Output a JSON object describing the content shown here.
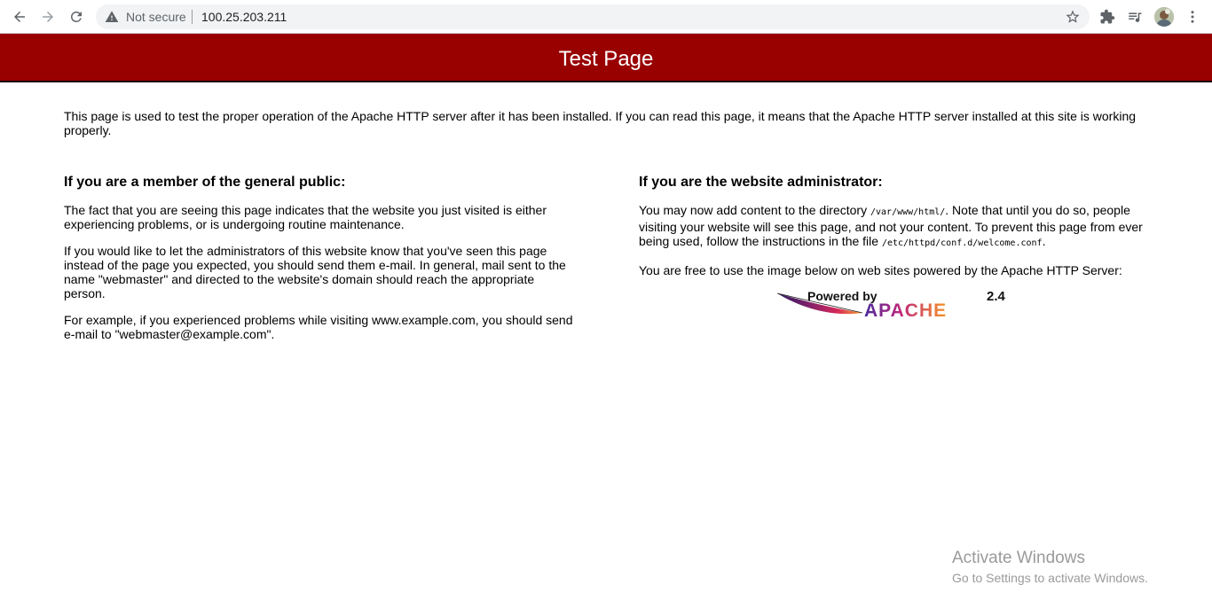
{
  "browser": {
    "security_label": "Not secure",
    "url": "100.25.203.211",
    "icons": [
      "back-icon",
      "forward-icon",
      "reload-icon",
      "warning-icon",
      "star-icon",
      "extensions-icon",
      "reading-list-icon",
      "avatar",
      "kebab-menu-icon"
    ]
  },
  "page": {
    "title": "Test Page",
    "intro": "This page is used to test the proper operation of the Apache HTTP server after it has been installed. If you can read this page, it means that the Apache HTTP server installed at this site is working properly.",
    "left": {
      "heading": "If you are a member of the general public:",
      "p1": "The fact that you are seeing this page indicates that the website you just visited is either experiencing problems, or is undergoing routine maintenance.",
      "p2": "If you would like to let the administrators of this website know that you've seen this page instead of the page you expected, you should send them e-mail. In general, mail sent to the name \"webmaster\" and directed to the website's domain should reach the appropriate person.",
      "p3": "For example, if you experienced problems while visiting www.example.com, you should send e-mail to \"webmaster@example.com\"."
    },
    "right": {
      "heading": "If you are the website administrator:",
      "p1_a": "You may now add content to the directory ",
      "p1_code1": "/var/www/html/",
      "p1_b": ". Note that until you do so, people visiting your website will see this page, and not your content. To prevent this page from ever being used, follow the instructions in the file ",
      "p1_code2": "/etc/httpd/conf.d/welcome.conf",
      "p1_c": ".",
      "p2": "You are free to use the image below on web sites powered by the Apache HTTP Server:"
    },
    "badge": {
      "powered_by": "Powered by",
      "version": "2.4",
      "name": "APACHE"
    }
  },
  "watermark": {
    "title": "Activate Windows",
    "subtitle": "Go to Settings to activate Windows."
  },
  "colors": {
    "banner": "#990000",
    "toolbar": "#ffffff",
    "omnibox": "#f1f3f4"
  }
}
